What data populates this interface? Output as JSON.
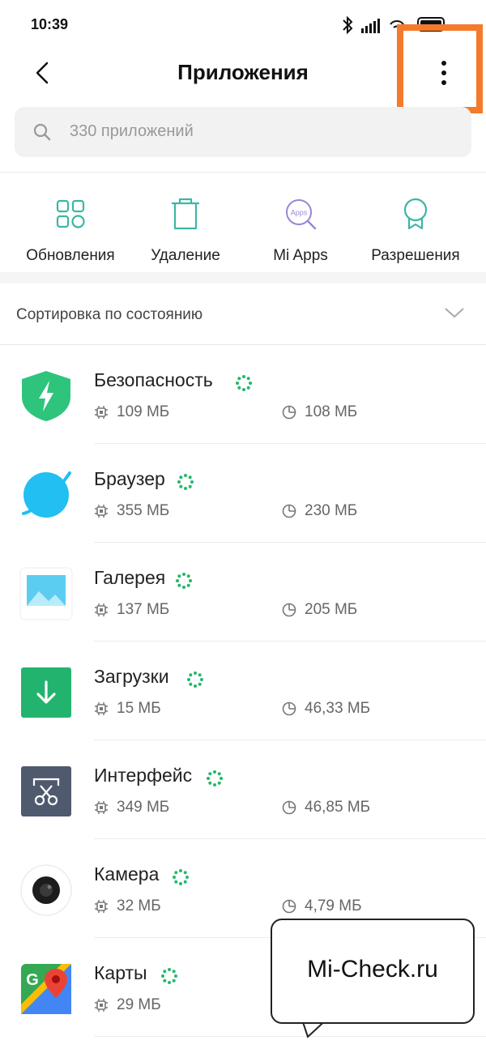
{
  "status_bar": {
    "time": "10:39"
  },
  "header": {
    "title": "Приложения"
  },
  "search": {
    "placeholder": "330 приложений"
  },
  "shortcuts": [
    {
      "label": "Обновления",
      "icon": "grid-icon"
    },
    {
      "label": "Удаление",
      "icon": "trash-icon"
    },
    {
      "label": "Mi Apps",
      "icon": "apps-search-icon",
      "icon_text": "Apps"
    },
    {
      "label": "Разрешения",
      "icon": "badge-icon"
    }
  ],
  "sort": {
    "label": "Сортировка по состоянию"
  },
  "apps": [
    {
      "name": "Безопасность",
      "memory": "109 МБ",
      "data": "108 МБ",
      "icon": "shield-icon"
    },
    {
      "name": "Браузер",
      "memory": "355 МБ",
      "data": "230 МБ",
      "icon": "browser-icon"
    },
    {
      "name": "Галерея",
      "memory": "137 МБ",
      "data": "205 МБ",
      "icon": "gallery-icon"
    },
    {
      "name": "Загрузки",
      "memory": "15 МБ",
      "data": "46,33 МБ",
      "icon": "downloads-icon"
    },
    {
      "name": "Интерфейс",
      "memory": "349 МБ",
      "data": "46,85 МБ",
      "icon": "interface-icon"
    },
    {
      "name": "Камера",
      "memory": "32 МБ",
      "data": "4,79 МБ",
      "icon": "camera-icon"
    },
    {
      "name": "Карты",
      "memory": "29 МБ",
      "data": "",
      "icon": "maps-icon",
      "icon_letter": "G"
    }
  ],
  "watermark": {
    "text": "Mi-Check.ru"
  },
  "colors": {
    "accent": "#25b86a",
    "highlight": "#f47a2c",
    "icon_teal": "#3cb7a4"
  }
}
